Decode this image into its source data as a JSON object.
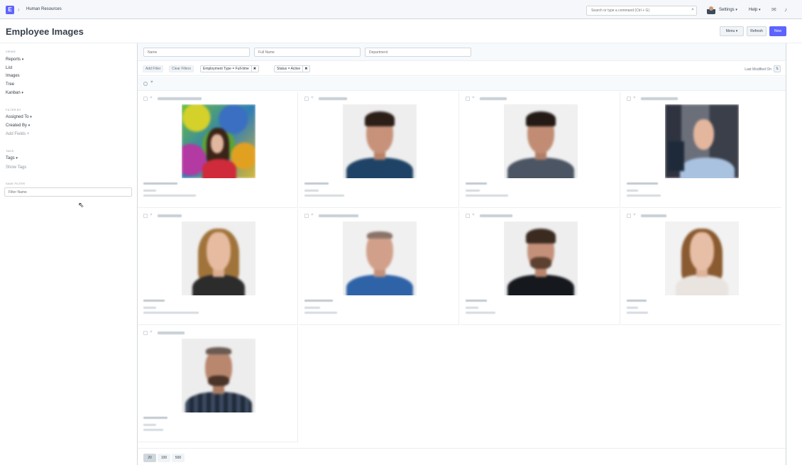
{
  "navbar": {
    "logo_letter": "E",
    "breadcrumb": "Human Resources",
    "search_placeholder": "Search or type a command (Ctrl + G)",
    "settings_label": "Settings",
    "help_label": "Help"
  },
  "page": {
    "title": "Employee Images",
    "menu_label": "Menu",
    "refresh_label": "Refresh",
    "new_label": "New"
  },
  "sidebar": {
    "views_heading": "VIEWS",
    "reports": "Reports",
    "list": "List",
    "images": "Images",
    "tree": "Tree",
    "kanban": "Kanban",
    "filter_heading": "FILTER BY",
    "assigned_to": "Assigned To",
    "created_by": "Created By",
    "add_fields": "Add Fields",
    "tags_heading": "TAGS",
    "tags": "Tags",
    "show_tags": "Show Tags",
    "save_filter_heading": "SAVE FILTER",
    "filter_name_placeholder": "Filter Name"
  },
  "filters": {
    "name_placeholder": "Name",
    "full_name_placeholder": "Full Name",
    "department_placeholder": "Department",
    "add_filter": "Add Filter",
    "clear_filters": "Clear Filters",
    "chips": [
      "Employment Type = Full-time",
      "Status = Active"
    ],
    "sort_label": "Last Modified On"
  },
  "paging": [
    "20",
    "100",
    "500"
  ],
  "colors": {
    "primary": "#5e64ff",
    "border": "#d1d8dd",
    "text": "#36414c",
    "muted": "#8d99a6"
  }
}
